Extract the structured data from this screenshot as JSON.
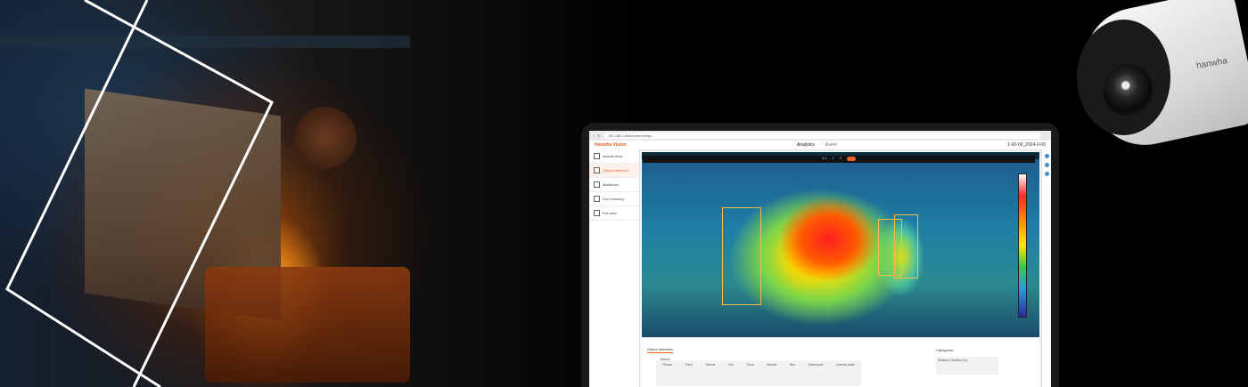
{
  "browser": {
    "url": "192.168.1.84/#/home/setup/..."
  },
  "app": {
    "logo": "Hanwha Vision",
    "tabs": [
      "Analytics",
      "Event"
    ],
    "active_tab": "Analytics",
    "header_right": "1-00-00_2024-0-00"
  },
  "sidebar": {
    "items": [
      {
        "label": "Include area",
        "active": false
      },
      {
        "label": "Object detection",
        "active": true
      },
      {
        "label": "Masklines",
        "active": false
      },
      {
        "label": "Line crossing",
        "active": false
      },
      {
        "label": "Full area",
        "active": false
      }
    ]
  },
  "viewer": {
    "toolbar_items": [
      "1:1",
      "1",
      "2"
    ]
  },
  "bottom": {
    "section_title": "Object detection",
    "object_label": "Object",
    "objects": [
      "Person",
      "Face",
      "Vehicle",
      "Car",
      "Truck",
      "Bicycle",
      "Bus",
      "Motorcycle",
      "License plate"
    ],
    "categories_label": "Categories",
    "min_duration_label": "Minimum duration (s)"
  },
  "camera": {
    "brand": "hanwha"
  },
  "colors": {
    "accent": "#e8622a",
    "frame": "#ffffff"
  }
}
